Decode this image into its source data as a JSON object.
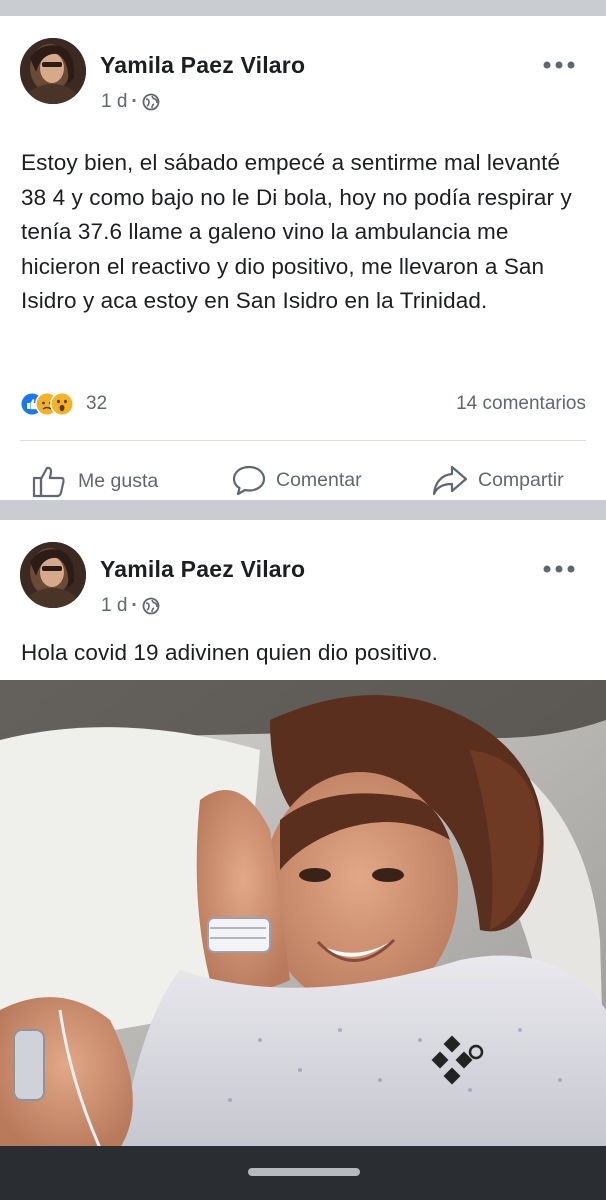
{
  "posts": [
    {
      "author": "Yamila Paez Vilaro",
      "time": "1 d",
      "separator": "·",
      "text": "Estoy bien, el sábado empecé a sentirme mal levanté 38 4 y como bajo no le Di bola, hoy no podía respirar y tenía 37.6 llame a galeno vino la ambulancia me hicieron el reactivo y dio positivo, me llevaron a San Isidro y aca estoy en San Isidro en la Trinidad.",
      "reaction_count": "32",
      "comments": "14 comentarios",
      "reaction_icons": [
        "like-icon",
        "sad-icon",
        "wow-icon"
      ],
      "actions": {
        "like": "Me gusta",
        "comment": "Comentar",
        "share": "Compartir"
      }
    },
    {
      "author": "Yamila Paez Vilaro",
      "time": "1 d",
      "separator": "·",
      "text": "Hola covid 19 adivinen quien dio positivo."
    }
  ],
  "colors": {
    "background": "#c9ccd1",
    "card": "#ffffff",
    "text_primary": "#1c1e21",
    "text_secondary": "#606770",
    "like_blue": "#1877f2",
    "reaction_yellow": "#f7b125",
    "nav_bar": "#2a2d31"
  }
}
